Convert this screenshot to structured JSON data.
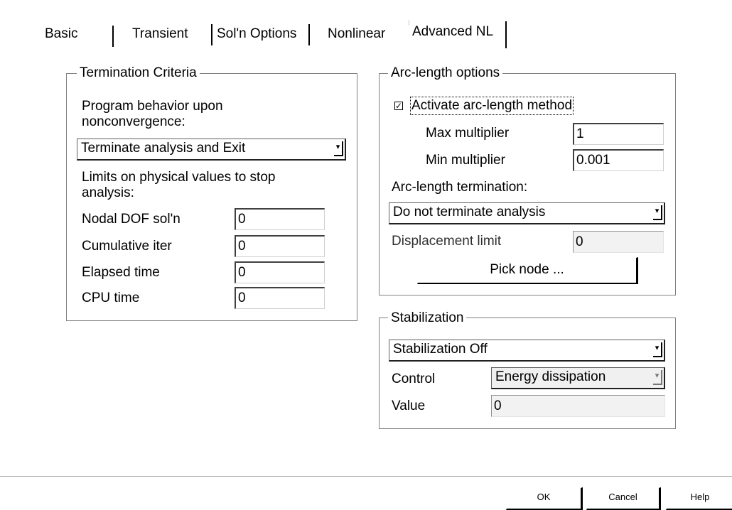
{
  "tabs": [
    {
      "label": "Basic"
    },
    {
      "label": "Transient"
    },
    {
      "label": "Sol'n Options"
    },
    {
      "label": "Nonlinear"
    },
    {
      "label": "Advanced NL",
      "active": true
    }
  ],
  "termination": {
    "title": "Termination Criteria",
    "behavior_label": "Program behavior upon nonconvergence:",
    "behavior_value": "Terminate analysis and Exit",
    "limits_label": "Limits on physical values to stop analysis:",
    "fields": [
      {
        "label": "Nodal DOF sol'n",
        "value": "0"
      },
      {
        "label": "Cumulative iter",
        "value": "0"
      },
      {
        "label": "Elapsed time",
        "value": "0"
      },
      {
        "label": "CPU time",
        "value": "0"
      }
    ]
  },
  "arc": {
    "title": "Arc-length options",
    "activate_label": "Activate arc-length method",
    "activate_checked": true,
    "max_label": "Max multiplier",
    "max_value": "1",
    "min_label": "Min multiplier",
    "min_value": "0.001",
    "termination_label": "Arc-length termination:",
    "termination_value": "Do not terminate analysis",
    "displacement_label": "Displacement limit",
    "displacement_value": "0",
    "pick_node_label": "Pick node ..."
  },
  "stabilization": {
    "title": "Stabilization",
    "mode_value": "Stabilization Off",
    "control_label": "Control",
    "control_value": "Energy dissipation",
    "value_label": "Value",
    "value_value": "0"
  },
  "footer": {
    "ok_label": "OK",
    "cancel_label": "Cancel",
    "help_label": "Help"
  }
}
